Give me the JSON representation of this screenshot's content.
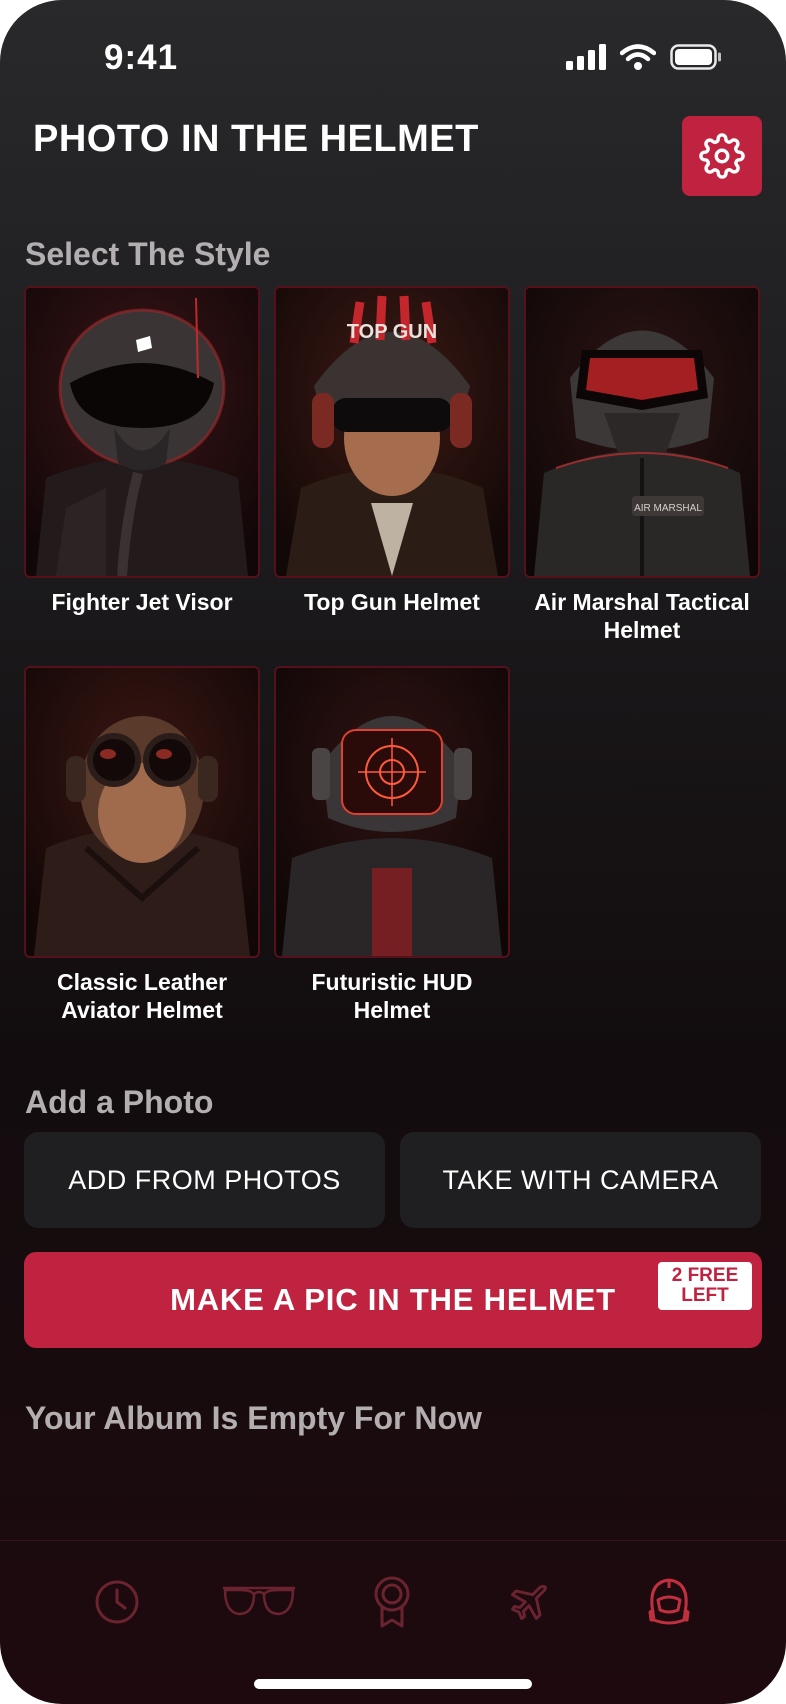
{
  "status_bar": {
    "time": "9:41"
  },
  "header": {
    "title": "PHOTO IN THE HELMET",
    "settings_icon": "gear-icon"
  },
  "styles_section": {
    "title": "Select The Style",
    "items": [
      {
        "label": "Fighter Jet Visor"
      },
      {
        "label": "Top Gun Helmet",
        "helmet_text": "TOP GUN"
      },
      {
        "label": "Air Marshal Tactical Helmet",
        "patch_text": "AIR MARSHAL"
      },
      {
        "label": "Classic Leather Aviator Helmet"
      },
      {
        "label": "Futuristic HUD Helmet"
      }
    ]
  },
  "photo_section": {
    "title": "Add a Photo",
    "add_from_photos": "ADD FROM PHOTOS",
    "take_with_camera": "TAKE WITH CAMERA"
  },
  "make_button": {
    "label": "MAKE A PIC IN THE HELMET",
    "badge_line1": "2 FREE",
    "badge_line2": "LEFT"
  },
  "album": {
    "empty_text": "Your Album Is Empty For Now"
  },
  "tab_bar": {
    "items": [
      {
        "icon": "clock-icon"
      },
      {
        "icon": "aviator-glasses-icon"
      },
      {
        "icon": "medal-icon"
      },
      {
        "icon": "airplane-icon"
      },
      {
        "icon": "helmet-icon",
        "active": true
      }
    ]
  },
  "colors": {
    "accent": "#bf2340",
    "background": "#1c1b1d",
    "button": "#1f1f22",
    "tab_inactive": "#6b2330",
    "tab_active": "#c0303f"
  }
}
